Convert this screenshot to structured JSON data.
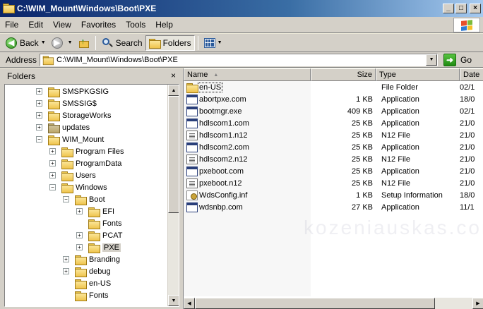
{
  "window": {
    "title": "C:\\WIM_Mount\\Windows\\Boot\\PXE",
    "minimize": "_",
    "maximize": "□",
    "close": "×"
  },
  "menu": [
    {
      "label": "File"
    },
    {
      "label": "Edit"
    },
    {
      "label": "View"
    },
    {
      "label": "Favorites"
    },
    {
      "label": "Tools"
    },
    {
      "label": "Help"
    }
  ],
  "toolbar": {
    "back_label": "Back",
    "search_label": "Search",
    "folders_label": "Folders"
  },
  "address": {
    "label": "Address",
    "path": "C:\\WIM_Mount\\Windows\\Boot\\PXE",
    "go_label": "Go"
  },
  "folders_pane": {
    "title": "Folders",
    "close": "×"
  },
  "tree": [
    {
      "label": "SMSPKGSIG",
      "indent": 0,
      "expander": "+",
      "special": false
    },
    {
      "label": "SMSSIG$",
      "indent": 0,
      "expander": "+",
      "special": false
    },
    {
      "label": "StorageWorks",
      "indent": 0,
      "expander": "+",
      "special": false
    },
    {
      "label": "updates",
      "indent": 0,
      "expander": "+",
      "special": true
    },
    {
      "label": "WIM_Mount",
      "indent": 0,
      "expander": "−",
      "special": false
    },
    {
      "label": "Program Files",
      "indent": 1,
      "expander": "+",
      "special": false
    },
    {
      "label": "ProgramData",
      "indent": 1,
      "expander": "+",
      "special": false
    },
    {
      "label": "Users",
      "indent": 1,
      "expander": "+",
      "special": false
    },
    {
      "label": "Windows",
      "indent": 1,
      "expander": "−",
      "special": false
    },
    {
      "label": "Boot",
      "indent": 2,
      "expander": "−",
      "special": false
    },
    {
      "label": "EFI",
      "indent": 3,
      "expander": "+",
      "special": false
    },
    {
      "label": "Fonts",
      "indent": 3,
      "expander": "",
      "special": false
    },
    {
      "label": "PCAT",
      "indent": 3,
      "expander": "+",
      "special": false
    },
    {
      "label": "PXE",
      "indent": 3,
      "expander": "+",
      "special": false,
      "selected": true
    },
    {
      "label": "Branding",
      "indent": 2,
      "expander": "+",
      "special": false
    },
    {
      "label": "debug",
      "indent": 2,
      "expander": "+",
      "special": false
    },
    {
      "label": "en-US",
      "indent": 2,
      "expander": "",
      "special": false
    },
    {
      "label": "Fonts",
      "indent": 2,
      "expander": "",
      "special": false
    }
  ],
  "columns": {
    "name": "Name",
    "size": "Size",
    "type": "Type",
    "date": "Date"
  },
  "files": [
    {
      "name": "en-US",
      "size": "",
      "type": "File Folder",
      "date": "02/1",
      "icon": "folder"
    },
    {
      "name": "abortpxe.com",
      "size": "1 KB",
      "type": "Application",
      "date": "18/0",
      "icon": "app"
    },
    {
      "name": "bootmgr.exe",
      "size": "409 KB",
      "type": "Application",
      "date": "02/1",
      "icon": "app"
    },
    {
      "name": "hdlscom1.com",
      "size": "25 KB",
      "type": "Application",
      "date": "21/0",
      "icon": "app"
    },
    {
      "name": "hdlscom1.n12",
      "size": "25 KB",
      "type": "N12 File",
      "date": "21/0",
      "icon": "doc"
    },
    {
      "name": "hdlscom2.com",
      "size": "25 KB",
      "type": "Application",
      "date": "21/0",
      "icon": "app"
    },
    {
      "name": "hdlscom2.n12",
      "size": "25 KB",
      "type": "N12 File",
      "date": "21/0",
      "icon": "doc"
    },
    {
      "name": "pxeboot.com",
      "size": "25 KB",
      "type": "Application",
      "date": "21/0",
      "icon": "app"
    },
    {
      "name": "pxeboot.n12",
      "size": "25 KB",
      "type": "N12 File",
      "date": "21/0",
      "icon": "doc"
    },
    {
      "name": "WdsConfig.inf",
      "size": "1 KB",
      "type": "Setup Information",
      "date": "18/0",
      "icon": "inf"
    },
    {
      "name": "wdsnbp.com",
      "size": "27 KB",
      "type": "Application",
      "date": "11/1",
      "icon": "app"
    }
  ],
  "watermark": "kozeniauskas.com"
}
